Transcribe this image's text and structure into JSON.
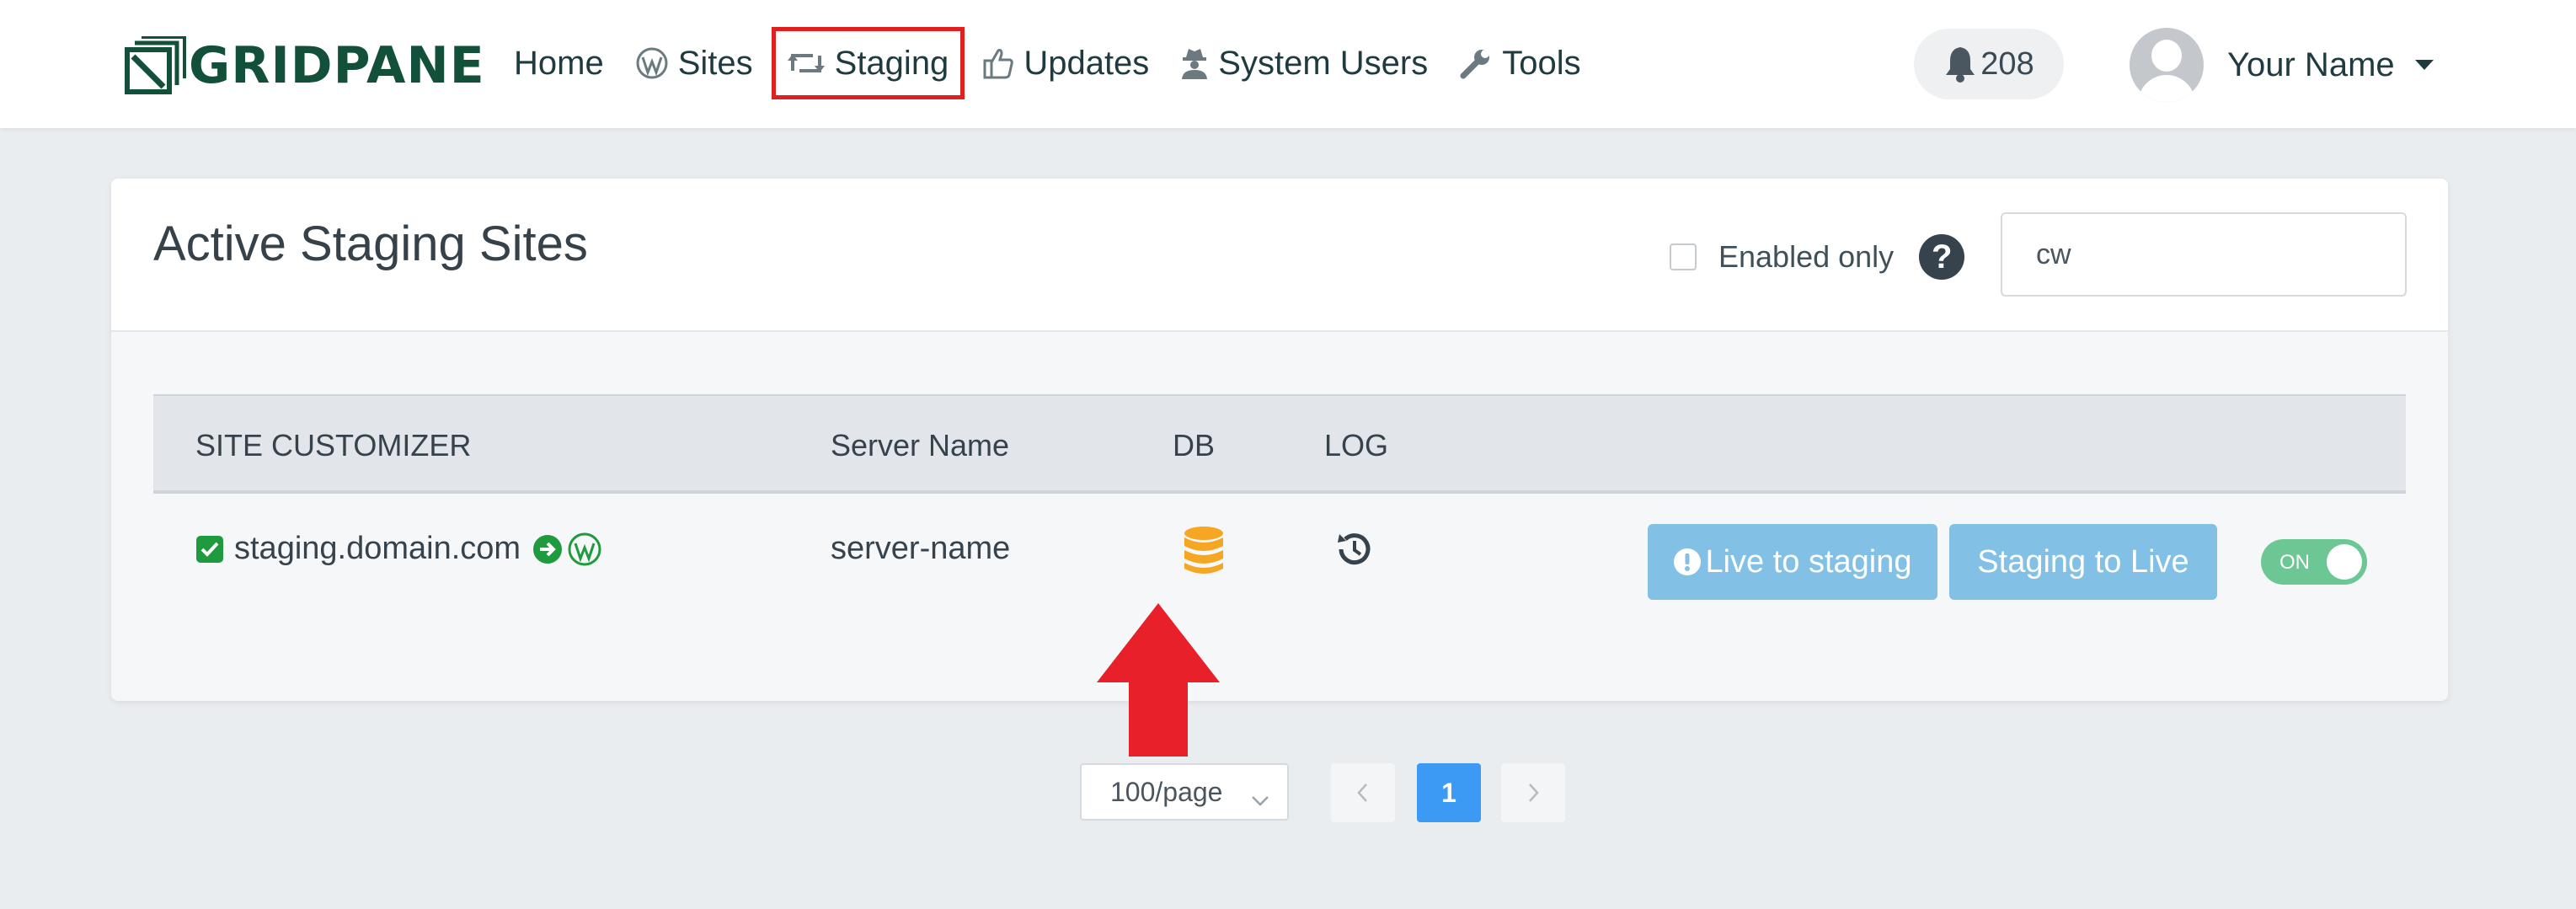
{
  "brand": {
    "logo_text": "GRIDPANE"
  },
  "nav": {
    "items": [
      {
        "label": "Home",
        "icon": "none"
      },
      {
        "label": "Sites",
        "icon": "wordpress-icon"
      },
      {
        "label": "Staging",
        "icon": "retweet-icon",
        "active": true
      },
      {
        "label": "Updates",
        "icon": "thumbs-up-icon"
      },
      {
        "label": "System Users",
        "icon": "user-secret-icon"
      },
      {
        "label": "Tools",
        "icon": "wrench-icon"
      }
    ],
    "notifications_count": "208",
    "user_name": "Your Name"
  },
  "card": {
    "title": "Active Staging Sites",
    "enabled_only_label": "Enabled only",
    "help_symbol": "?",
    "search_value": "cw"
  },
  "table": {
    "headers": [
      "SITE CUSTOMIZER",
      "Server Name",
      "DB",
      "LOG"
    ],
    "rows": [
      {
        "site": "staging.domain.com",
        "server": "server-name",
        "live_to_staging_label": "Live to staging",
        "staging_to_live_label": "Staging to Live",
        "toggle_label": "ON"
      }
    ]
  },
  "pagination": {
    "per_page": "100/page",
    "current_page": "1"
  },
  "colors": {
    "brand_green": "#12503a",
    "annotation_red": "#e0201f",
    "button_blue": "#82c0e6",
    "toggle_green": "#6cc795",
    "db_icon_orange": "#f5a623",
    "page_active_blue": "#3c99f4"
  }
}
